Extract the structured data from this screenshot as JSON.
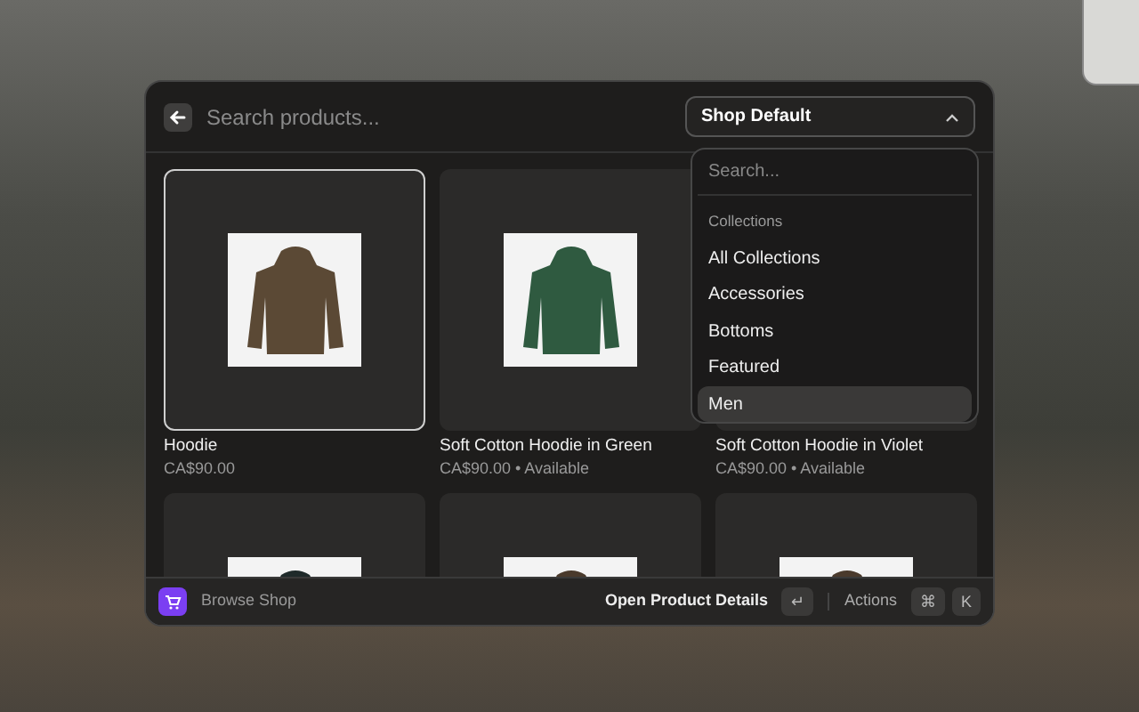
{
  "search": {
    "placeholder": "Search products..."
  },
  "shop_select": {
    "value": "Shop Default",
    "expanded": true
  },
  "dropdown": {
    "search_placeholder": "Search...",
    "section": "Collections",
    "items": [
      {
        "label": "All Collections",
        "selected": false
      },
      {
        "label": "Accessories",
        "selected": false
      },
      {
        "label": "Bottoms",
        "selected": false
      },
      {
        "label": "Featured",
        "selected": false
      },
      {
        "label": "Men",
        "selected": true
      }
    ]
  },
  "products": [
    {
      "title": "Hoodie",
      "price": "CA$90.00",
      "color": "#5b4935",
      "selected": true
    },
    {
      "title": "Soft Cotton Hoodie in Green",
      "price": "CA$90.00 • Available",
      "color": "#2f5a40",
      "selected": false
    },
    {
      "title": "Soft Cotton Hoodie in Violet",
      "price": "CA$90.00 • Available",
      "selected": false
    },
    {
      "color": "#1f2a2a",
      "selected": false
    },
    {
      "color": "#4a3a2c",
      "selected": false
    },
    {
      "color": "#4a3a2c",
      "selected": false
    }
  ],
  "footer": {
    "app": "Browse Shop",
    "primary_action": "Open Product Details",
    "primary_key": "↵",
    "actions_label": "Actions",
    "actions_keys": [
      "⌘",
      "K"
    ]
  }
}
